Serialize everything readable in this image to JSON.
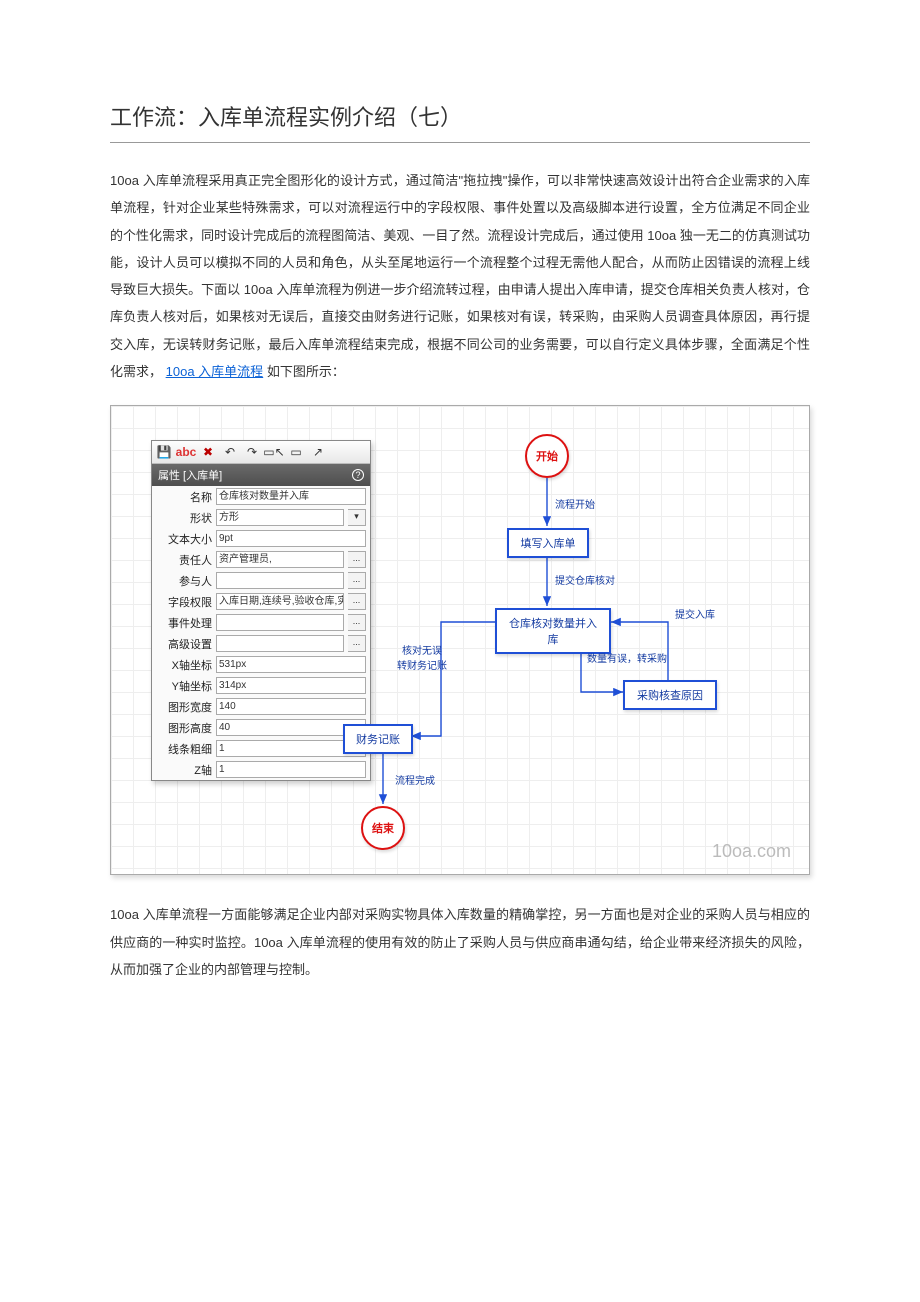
{
  "title": "工作流：入库单流程实例介绍（七）",
  "para1_a": "10oa 入库单流程采用真正完全图形化的设计方式，通过简洁\"拖拉拽\"操作，可以非常快速高效设计出符合企业需求的入库单流程，针对企业某些特殊需求，可以对流程运行中的字段权限、事件处置以及高级脚本进行设置，全方位满足不同企业的个性化需求，同时设计完成后的流程图简洁、美观、一目了然。流程设计完成后，通过使用 10oa 独一无二的仿真测试功能，设计人员可以模拟不同的人员和角色，从头至尾地运行一个流程整个过程无需他人配合，从而防止因错误的流程上线导致巨大损失。下面以 10oa 入库单流程为例进一步介绍流转过程，由申请人提出入库申请，提交仓库相关负责人核对，仓库负责人核对后，如果核对无误后，直接交由财务进行记账，如果核对有误，转采购，由采购人员调查具体原因，再行提交入库，无误转财务记账，最后入库单流程结束完成，根据不同公司的业务需要，可以自行定义具体步骤，全面满足个性化需求，",
  "link_text": "10oa  入库单流程",
  "para1_b": "如下图所示：",
  "para2": "10oa 入库单流程一方面能够满足企业内部对采购实物具体入库数量的精确掌控，另一方面也是对企业的采购人员与相应的供应商的一种实时监控。10oa 入库单流程的使用有效的防止了采购人员与供应商串通勾结，给企业带来经济损失的风险，从而加强了企业的内部管理与控制。",
  "panel": {
    "title": "属性  [入库单]",
    "rows": {
      "name_lbl": "名称",
      "name_val": "仓库核对数量并入库",
      "shape_lbl": "形状",
      "shape_val": "方形",
      "fsize_lbl": "文本大小",
      "fsize_val": "9pt",
      "resp_lbl": "责任人",
      "resp_val": "资产管理员,",
      "part_lbl": "参与人",
      "part_val": "",
      "fperm_lbl": "字段权限",
      "fperm_val": "入库日期,连续号,验收仓库,实收到",
      "evt_lbl": "事件处理",
      "evt_val": "",
      "adv_lbl": "高级设置",
      "adv_val": "",
      "x_lbl": "X轴坐标",
      "x_val": "531px",
      "y_lbl": "Y轴坐标",
      "y_val": "314px",
      "w_lbl": "图形宽度",
      "w_val": "140",
      "h_lbl": "图形高度",
      "h_val": "40",
      "lw_lbl": "线条粗细",
      "lw_val": "1",
      "z_lbl": "Z轴",
      "z_val": "1"
    }
  },
  "flow": {
    "start": "开始",
    "fill": "填写入库单",
    "check": "仓库核对数量并入库",
    "reason": "采购核查原因",
    "acct": "财务记账",
    "end": "结束",
    "l_start": "流程开始",
    "l_submit": "提交仓库核对",
    "l_ok": "核对无误\n转财务记账",
    "l_err": "数量有误，转采购",
    "l_resub": "提交入库",
    "l_done": "流程完成"
  },
  "watermark": "10oa.com"
}
